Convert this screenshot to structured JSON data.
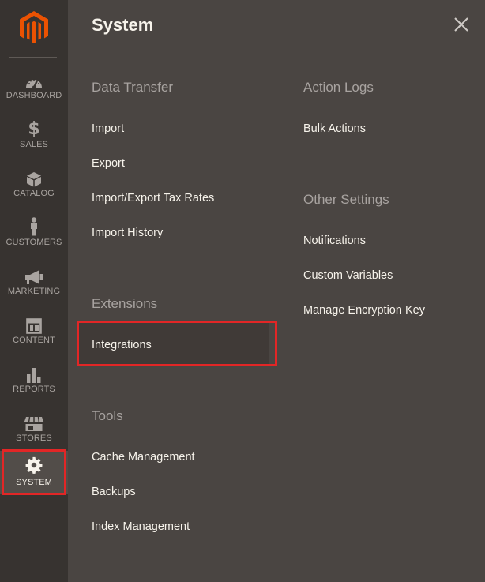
{
  "sidebar": {
    "logo": "magento-logo-icon",
    "items": [
      {
        "key": "dashboard",
        "label": "DASHBOARD",
        "icon": "speedometer-icon"
      },
      {
        "key": "sales",
        "label": "SALES",
        "icon": "dollar-icon"
      },
      {
        "key": "catalog",
        "label": "CATALOG",
        "icon": "box-icon"
      },
      {
        "key": "customers",
        "label": "CUSTOMERS",
        "icon": "person-icon"
      },
      {
        "key": "marketing",
        "label": "MARKETING",
        "icon": "megaphone-icon"
      },
      {
        "key": "content",
        "label": "CONTENT",
        "icon": "layout-icon"
      },
      {
        "key": "reports",
        "label": "REPORTS",
        "icon": "bar-chart-icon"
      },
      {
        "key": "stores",
        "label": "STORES",
        "icon": "storefront-icon"
      },
      {
        "key": "system",
        "label": "SYSTEM",
        "icon": "gear-icon",
        "active": true
      }
    ]
  },
  "panel": {
    "title": "System",
    "close_icon": "close-icon",
    "sections": {
      "data_transfer": {
        "title": "Data Transfer",
        "links": [
          "Import",
          "Export",
          "Import/Export Tax Rates",
          "Import History"
        ]
      },
      "extensions": {
        "title": "Extensions",
        "links": [
          "Integrations"
        ]
      },
      "tools": {
        "title": "Tools",
        "links": [
          "Cache Management",
          "Backups",
          "Index Management"
        ]
      },
      "action_logs": {
        "title": "Action Logs",
        "links": [
          "Bulk Actions"
        ]
      },
      "other_settings": {
        "title": "Other Settings",
        "links": [
          "Notifications",
          "Custom Variables",
          "Manage Encryption Key"
        ]
      }
    }
  },
  "colors": {
    "sidebar_bg": "#373330",
    "panel_bg": "#4a4542",
    "accent_logo": "#eb5202",
    "highlight": "#e22626"
  }
}
